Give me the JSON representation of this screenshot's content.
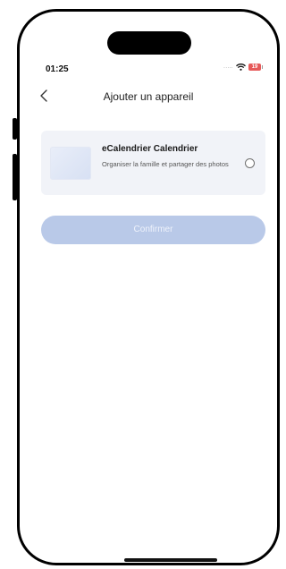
{
  "status_bar": {
    "time": "01:25",
    "signal_dots": ".....",
    "battery": "19"
  },
  "header": {
    "title": "Ajouter un appareil"
  },
  "device": {
    "name": "eCalendrier Calendrier",
    "description": "Organiser la famille et partager des photos",
    "selected": false
  },
  "actions": {
    "confirm_label": "Confirmer"
  },
  "icons": {
    "back": "chevron-left-icon",
    "wifi": "wifi-icon",
    "battery": "battery-icon",
    "radio": "radio-unselected-icon"
  },
  "colors": {
    "card_bg": "#f1f3f8",
    "confirm_bg": "#b9c9e8",
    "battery": "#e65a5a"
  }
}
